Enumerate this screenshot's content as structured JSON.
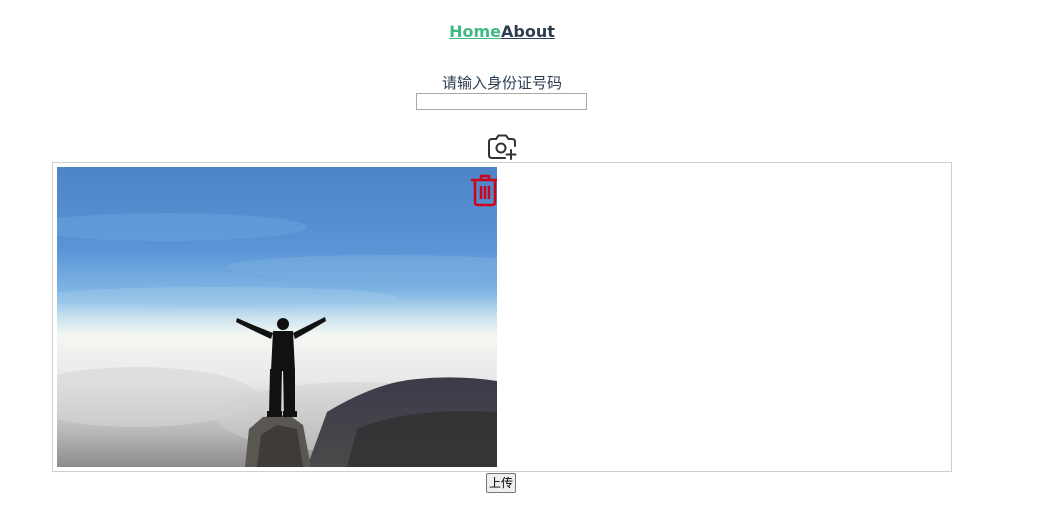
{
  "nav": {
    "home_label": "Home",
    "about_label": "About"
  },
  "form": {
    "id_label": "请输入身份证号码",
    "id_value": ""
  },
  "upload": {
    "camera_icon": "camera-add-icon",
    "trash_icon": "trash-icon",
    "submit_label": "上传"
  },
  "colors": {
    "active_link": "#42b983",
    "text": "#2c3e50",
    "delete": "#d0021b"
  }
}
